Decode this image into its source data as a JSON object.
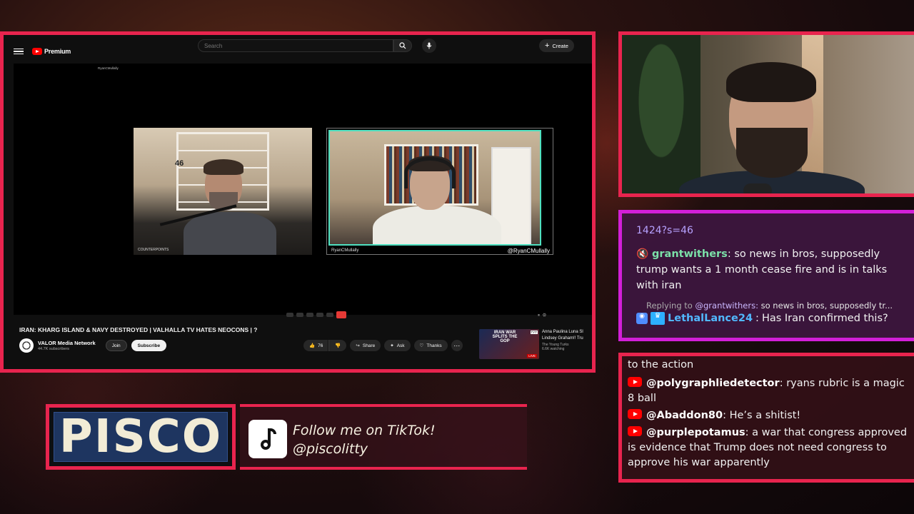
{
  "youtube": {
    "brand": "Premium",
    "search_placeholder": "Search",
    "create_label": "Create",
    "video_tl_label": "RyanCMullally",
    "pane_left_tag": "COUNTERPOINTS",
    "pane_left_number": "46",
    "pane_right_label_left": "RyanCMullally",
    "pane_right_label_right": "@RyanCMullally",
    "title": "IRAN: KHARG ISLAND & NAVY DESTROYED | VALHALLA TV HATES NEOCONS | ?",
    "channel_name": "VALOR Media Network",
    "channel_subs": "44.7K subscribers",
    "join_label": "Join",
    "subscribe_label": "Subscribe",
    "like_count": "76",
    "share_label": "Share",
    "ask_label": "Ask",
    "thanks_label": "Thanks",
    "rec": {
      "thumb_text": "IRAN WAR SPLITS THE GOP",
      "thumb_corner": "TYT",
      "live": "LIVE",
      "title_line1": "Anna Paulina Luna Sl",
      "title_line2": "Lindsey Graham!! Tru",
      "channel": "The Young Turks",
      "watching": "6.6K watching"
    }
  },
  "chat_top": {
    "url_fragment": "1424?s=46",
    "msg1_user": "grantwithers",
    "msg1_text": "so news in bros, supposedly trump wants a 1 month cease fire and is in talks with iran",
    "reply_prefix": "Replying to",
    "reply_user": "@grantwithers:",
    "reply_text": "so news in bros, supposedly tr...",
    "msg2_user": "LethalLance24",
    "msg2_text": "Has Iran confirmed this?"
  },
  "chat_bottom": {
    "lead": "to the action",
    "messages": [
      {
        "user": "@polygraphliedetector",
        "text": "ryans rubric is a magic 8 ball"
      },
      {
        "user": "@Abaddon80",
        "text": "He’s a shitist!"
      },
      {
        "user": "@purplepotamus",
        "text": "a war that congress approved is evidence that Trump does not need congress to approve his war apparently"
      }
    ]
  },
  "banner": {
    "name": "PISCO",
    "tiktok_line1": "Follow me on TikTok!",
    "tiktok_line2": "@piscolitty"
  },
  "colors": {
    "frame_accent": "#e8244e",
    "chat_top_border": "#d21fd8",
    "youtube_red": "#ff0000"
  }
}
